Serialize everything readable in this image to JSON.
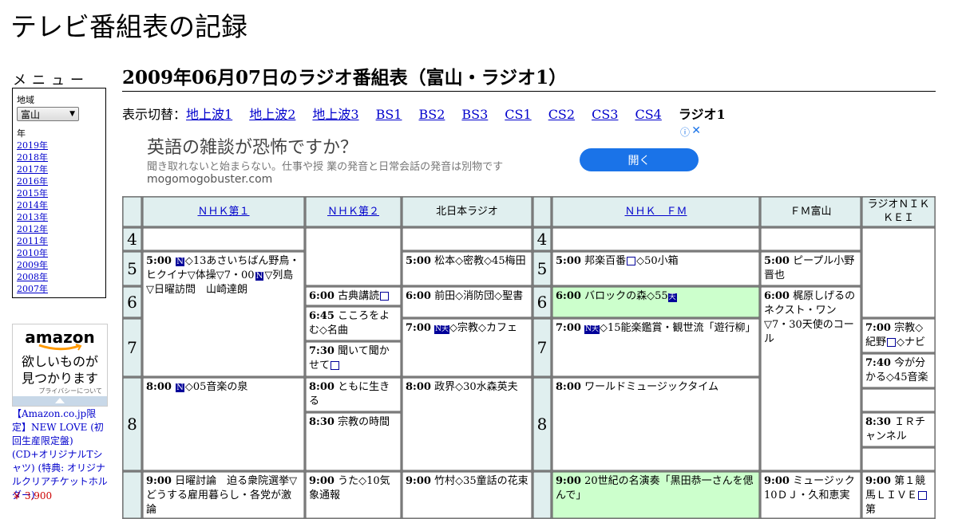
{
  "site_title": "テレビ番組表の記録",
  "sidebar": {
    "menu_title": "メニュー",
    "region_label": "地域",
    "region_value": "富山",
    "year_label": "年",
    "years": [
      "2019年",
      "2018年",
      "2017年",
      "2016年",
      "2015年",
      "2014年",
      "2013年",
      "2012年",
      "2011年",
      "2010年",
      "2009年",
      "2008年",
      "2007年"
    ]
  },
  "amazon": {
    "logo": "amazon",
    "tagline_1": "欲しいものが",
    "tagline_2": "見つかります",
    "privacy": "プライバシーについて",
    "promo_text": "【Amazon.co.jp限定】NEW LOVE (初回生産限定盤) (CD+オリジナルTシャツ) (特典: オリジナルクリアチケットホルダー)",
    "price": "￥ 3,900"
  },
  "page_heading": "2009年06月07日のラジオ番組表（富山・ラジオ1）",
  "switcher": {
    "label": "表示切替：",
    "links": [
      "地上波1",
      "地上波2",
      "地上波3",
      "BS1",
      "BS2",
      "BS3",
      "CS1",
      "CS2",
      "CS3",
      "CS4"
    ],
    "current": "ラジオ1"
  },
  "ad": {
    "title": "英語の雑談が恐怖ですか？",
    "description": "聞き取れないと始まらない。仕事や授 業の発音と日常会話の発音は別物です",
    "domain": "mogomogobuster.com",
    "button": "開く",
    "info_icon": "ⓘ",
    "close_icon": "✕"
  },
  "channels": [
    "ＮＨＫ第１",
    "ＮＨＫ第２",
    "北日本ラジオ",
    "ＮＨＫ　ＦＭ",
    "ＦＭ富山",
    "ラジオＮＩＫＫＥＩ"
  ],
  "hours": [
    "4",
    "5",
    "6",
    "7",
    "8"
  ],
  "programs": {
    "nhk1_5": {
      "time": "5:00",
      "badge": "N",
      "text": "◇13あさいちばん野鳥・ヒクイナ▽体操▽7・00",
      "badge2": "N",
      "text2": "▽列島▽日曜訪問　山崎達朗"
    },
    "nhk1_8": {
      "time": "8:00",
      "badge": "N",
      "text": "◇05音楽の泉"
    },
    "nhk1_9": {
      "time": "9:00",
      "text": "日曜討論　迫る衆院選挙▽どうする雇用暮らし・各党が激論"
    },
    "nhk2_6": {
      "time": "6:00",
      "text": "古典講読"
    },
    "nhk2_645": {
      "time": "6:45",
      "text": "こころをよむ◇名曲"
    },
    "nhk2_730": {
      "time": "7:30",
      "text": "聞いて聞かせて"
    },
    "nhk2_8": {
      "time": "8:00",
      "text": "ともに生きる"
    },
    "nhk2_830": {
      "time": "8:30",
      "text": "宗教の時間"
    },
    "nhk2_9": {
      "time": "9:00",
      "text": "うた◇10気象通報"
    },
    "knb_5": {
      "time": "5:00",
      "text": "松本◇密教◇45梅田"
    },
    "knb_6": {
      "time": "6:00",
      "text": "前田◇消防団◇聖書"
    },
    "knb_7": {
      "time": "7:00",
      "badge": "N天",
      "text": "◇宗教◇カフェ"
    },
    "knb_8": {
      "time": "8:00",
      "text": "政界◇30水森英夫"
    },
    "knb_9": {
      "time": "9:00",
      "text": "竹村◇35童話の花束"
    },
    "fm_5": {
      "time": "5:00",
      "text": "邦楽百番",
      "text2": "◇50小箱"
    },
    "fm_6": {
      "time": "6:00",
      "text": "バロックの森◇55"
    },
    "fm_7": {
      "time": "7:00",
      "badge": "N天",
      "text": "◇15能楽鑑賞・観世流「遊行柳」"
    },
    "fm_8": {
      "time": "8:00",
      "text": "ワールドミュージックタイム"
    },
    "fm_9": {
      "time": "9:00",
      "text": "20世紀の名演奏「黒田恭一さんを偲んで」"
    },
    "fmt_5": {
      "time": "5:00",
      "text": "ピープル小野晋也"
    },
    "fmt_6": {
      "time": "6:00",
      "text": "梶原しげるのネクスト・ワン▽7・30天使のコール"
    },
    "fmt_9": {
      "time": "9:00",
      "text": "ミュージック10ＤＪ・久和恵実"
    },
    "nikkei_7": {
      "time": "7:00",
      "text": "宗教◇紀野",
      "text2": "◇ナビ"
    },
    "nikkei_740": {
      "time": "7:40",
      "text": "今が分かる◇45音楽"
    },
    "nikkei_830": {
      "time": "8:30",
      "text": "ＩＲチャンネル"
    },
    "nikkei_9": {
      "time": "9:00",
      "text": "第１競馬ＬＩＶＥ",
      "text2": "第"
    }
  }
}
